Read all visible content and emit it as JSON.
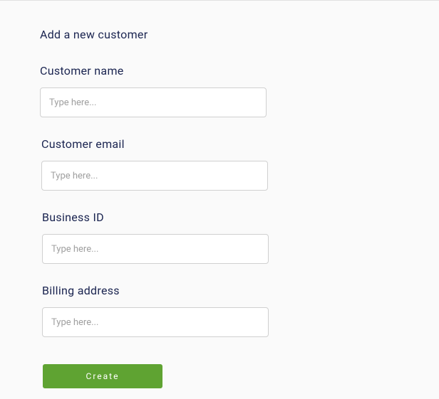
{
  "form": {
    "title": "Add a new customer",
    "fields": {
      "name": {
        "label": "Customer name",
        "placeholder": "Type here..."
      },
      "email": {
        "label": "Customer email",
        "placeholder": "Type here..."
      },
      "business_id": {
        "label": "Business ID",
        "placeholder": "Type here..."
      },
      "billing_address": {
        "label": "Billing address",
        "placeholder": "Type here..."
      }
    },
    "submit_label": "Create"
  }
}
